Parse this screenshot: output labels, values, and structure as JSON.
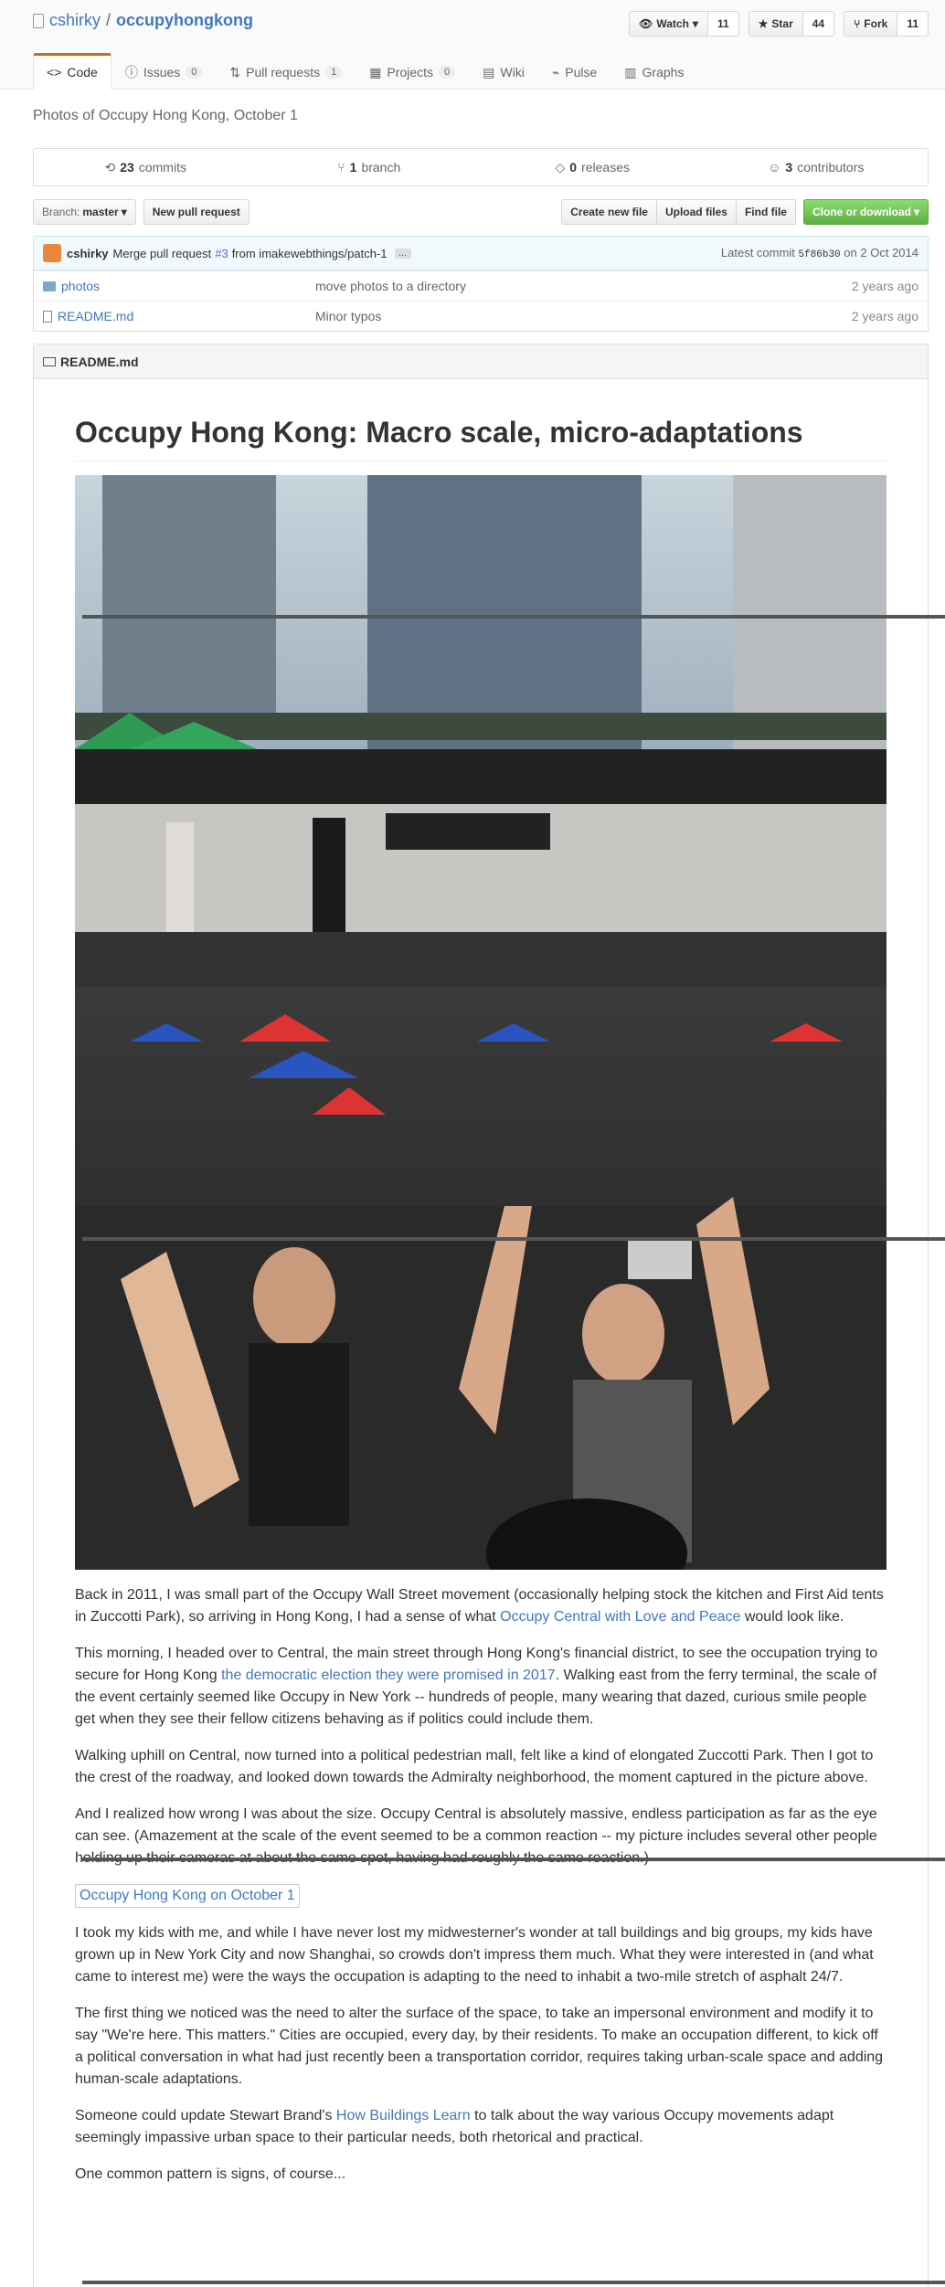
{
  "header": {
    "owner": "cshirky",
    "separator": "/",
    "repo": "occupyhongkong",
    "watch_label": "Watch",
    "watch_count": "11",
    "star_label": "Star",
    "star_count": "44",
    "fork_label": "Fork",
    "fork_count": "11"
  },
  "tabs": [
    {
      "label": "Code"
    },
    {
      "label": "Issues",
      "count": "0"
    },
    {
      "label": "Pull requests",
      "count": "1"
    },
    {
      "label": "Projects",
      "count": "0"
    },
    {
      "label": "Wiki"
    },
    {
      "label": "Pulse"
    },
    {
      "label": "Graphs"
    }
  ],
  "description": "Photos of Occupy Hong Kong, October 1",
  "numbers": {
    "commits": "23",
    "commits_label": "commits",
    "branches": "1",
    "branches_label": "branch",
    "releases": "0",
    "releases_label": "releases",
    "contributors": "3",
    "contributors_label": "contributors"
  },
  "filebar": {
    "branch_prefix": "Branch:",
    "branch": "master",
    "new_pr": "New pull request",
    "create_file": "Create new file",
    "upload": "Upload files",
    "find": "Find file",
    "clone": "Clone or download"
  },
  "commit": {
    "author": "cshirky",
    "msg_prefix": "Merge pull request",
    "pr": "#3",
    "msg_suffix": "from imakewebthings/patch-1",
    "latest_label": "Latest commit",
    "sha": "5f86b30",
    "on": "on",
    "date": "2 Oct 2014"
  },
  "files": [
    {
      "name": "photos",
      "message": "move photos to a directory",
      "age": "2 years ago",
      "type": "folder"
    },
    {
      "name": "README.md",
      "message": "Minor typos",
      "age": "2 years ago",
      "type": "file"
    }
  ],
  "readme": {
    "filename": "README.md",
    "title": "Occupy Hong Kong: Macro scale, micro-adaptations",
    "p1_a": "Back in 2011, I was small part of the Occupy Wall Street movement (occasionally helping stock the kitchen and First Aid tents in Zuccotti Park), so arriving in Hong Kong, I had a sense of what ",
    "p1_link": "Occupy Central with Love and Peace",
    "p1_b": " would look like.",
    "p2_a": "This morning, I headed over to Central, the main street through Hong Kong's financial district, to see the occupation trying to secure for Hong Kong ",
    "p2_link": "the democratic election they were promised in 2017",
    "p2_b": ". Walking east from the ferry terminal, the scale of the event certainly seemed like Occupy in New York -- hundreds of people, many wearing that dazed, curious smile people get when they see their fellow citizens behaving as if politics could include them.",
    "p3": "Walking uphill on Central, now turned into a political pedestrian mall, felt like a kind of elongated Zuccotti Park. Then I got to the crest of the roadway, and looked down towards the Admiralty neighborhood, the moment captured in the picture above.",
    "p4": "And I realized how wrong I was about the size. Occupy Central is absolutely massive, endless participation as far as the eye can see. (Amazement at the scale of the event seemed to be a common reaction -- my picture includes several other people holding up their cameras at about the same spot, having had roughly the same reaction.)",
    "img_alt": "Occupy Hong Kong on October 1",
    "p5": "I took my kids with me, and while I have never lost my midwesterner's wonder at tall buildings and big groups, my kids have grown up in New York City and now Shanghai, so crowds don't impress them much. What they were interested in (and what came to interest me) were the ways the occupation is adapting to the need to inhabit a two-mile stretch of asphalt 24/7.",
    "p6": "The first thing we noticed was the need to alter the surface of the space, to take an impersonal environment and modify it to say \"We're here. This matters.\" Cities are occupied, every day, by their residents. To make an occupation different, to kick off a political conversation in what had just recently been a transportation corridor, requires taking urban-scale space and adding human-scale adaptations.",
    "p7_a": "Someone could update Stewart Brand's ",
    "p7_link": "How Buildings Learn",
    "p7_b": " to talk about the way various Occupy movements adapt seemingly impassive urban space to their particular needs, both rhetorical and practical.",
    "p8": "One common pattern is signs, of course..."
  }
}
